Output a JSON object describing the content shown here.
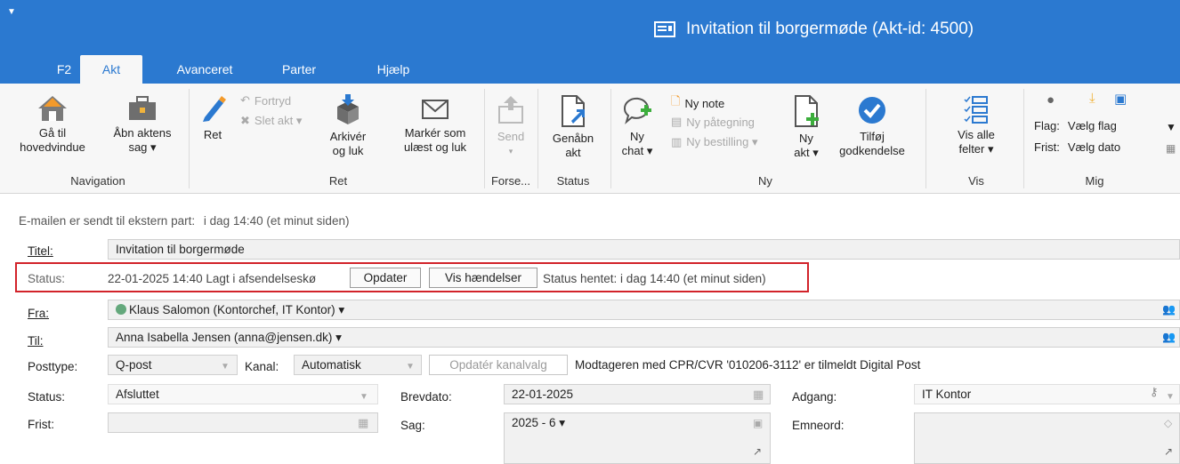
{
  "window": {
    "quick_access": "▼",
    "title": "Invitation til borgermøde (Akt-id: 4500)"
  },
  "tabs": [
    "F2",
    "Akt",
    "Avanceret",
    "Parter",
    "Hjælp"
  ],
  "ribbon": {
    "navigation": {
      "group": "Navigation",
      "goto_line1": "Gå til",
      "goto_line2": "hovedvindue",
      "open_line1": "Åbn aktens",
      "open_line2": "sag ▾"
    },
    "ret": {
      "group": "Ret",
      "ret": "Ret",
      "undo": "Fortryd",
      "delete": "Slet akt ▾",
      "archive_line1": "Arkivér",
      "archive_line2": "og luk",
      "mark_line1": "Markér som",
      "mark_line2": "ulæst og luk"
    },
    "send": {
      "group": "Forse...",
      "label": "Send",
      "arrow": "▾"
    },
    "status": {
      "group": "Status",
      "reopen_line1": "Genåbn",
      "reopen_line2": "akt"
    },
    "ny": {
      "group": "Ny",
      "chat_line1": "Ny",
      "chat_line2": "chat ▾",
      "note": "Ny note",
      "annotation": "Ny påtegning",
      "order": "Ny bestilling ▾",
      "akt_line1": "Ny",
      "akt_line2": "akt ▾",
      "approve_line1": "Tilføj",
      "approve_line2": "godkendelse"
    },
    "vis": {
      "group": "Vis",
      "line1": "Vis alle",
      "line2": "felter ▾"
    },
    "mig": {
      "group": "Mig",
      "flag_label": "Flag:",
      "flag_value": "Vælg flag",
      "deadline_label": "Frist:",
      "deadline_value": "Vælg dato"
    }
  },
  "form": {
    "info_label": "E-mailen er sendt til ekstern part:",
    "info_value": "i dag 14:40 (et minut siden)",
    "title_label": "Titel:",
    "title_value": "Invitation til borgermøde",
    "status_label": "Status:",
    "status_value": "22-01-2025 14:40 Lagt i afsendelseskø",
    "update_button": "Opdater",
    "events_button": "Vis hændelser",
    "status_fetched": "Status hentet: i dag 14:40 (et minut siden)",
    "from_label": "Fra:",
    "from_value": "Klaus Salomon (Kontorchef, IT Kontor) ▾",
    "to_label": "Til:",
    "to_value": "Anna Isabella Jensen (anna@jensen.dk) ▾",
    "posttype_label": "Posttype:",
    "posttype_value": "Q-post",
    "channel_label": "Kanal:",
    "channel_value": "Automatisk",
    "channel_button": "Opdatér kanalvalg",
    "digital_post_note": "Modtageren med CPR/CVR '010206-3112' er tilmeldt Digital Post",
    "status2_label": "Status:",
    "status2_value": "Afsluttet",
    "letterdate_label": "Brevdato:",
    "letterdate_value": "22-01-2025",
    "access_label": "Adgang:",
    "access_value": "IT Kontor",
    "deadline_label": "Frist:",
    "deadline_value": "",
    "case_label": "Sag:",
    "case_value": "2025 - 6 ▾",
    "keywords_label": "Emneord:"
  },
  "colors": {
    "accent": "#2b79d0",
    "highlight_border": "#d2232a",
    "ribbon_bg": "#f7f7f7"
  }
}
